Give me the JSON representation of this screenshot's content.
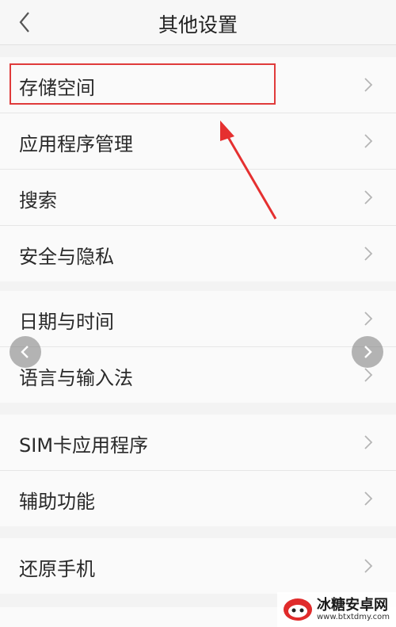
{
  "header": {
    "title": "其他设置",
    "back_icon": "chevron-left-icon"
  },
  "groups": [
    {
      "items": [
        {
          "label": "存储空间"
        },
        {
          "label": "应用程序管理"
        },
        {
          "label": "搜索"
        },
        {
          "label": "安全与隐私"
        }
      ]
    },
    {
      "items": [
        {
          "label": "日期与时间"
        },
        {
          "label": "语言与输入法"
        }
      ]
    },
    {
      "items": [
        {
          "label": "SIM卡应用程序"
        },
        {
          "label": "辅助功能"
        }
      ]
    },
    {
      "items": [
        {
          "label": "还原手机"
        }
      ]
    }
  ],
  "annotation": {
    "highlight_color": "#e03b3b",
    "highlighted_item": "存储空间"
  },
  "overlay": {
    "prev_icon": "chevron-left-icon",
    "next_icon": "chevron-right-icon"
  },
  "watermark": {
    "name": "冰糖安卓网",
    "url": "www.btxtdmy.com"
  }
}
